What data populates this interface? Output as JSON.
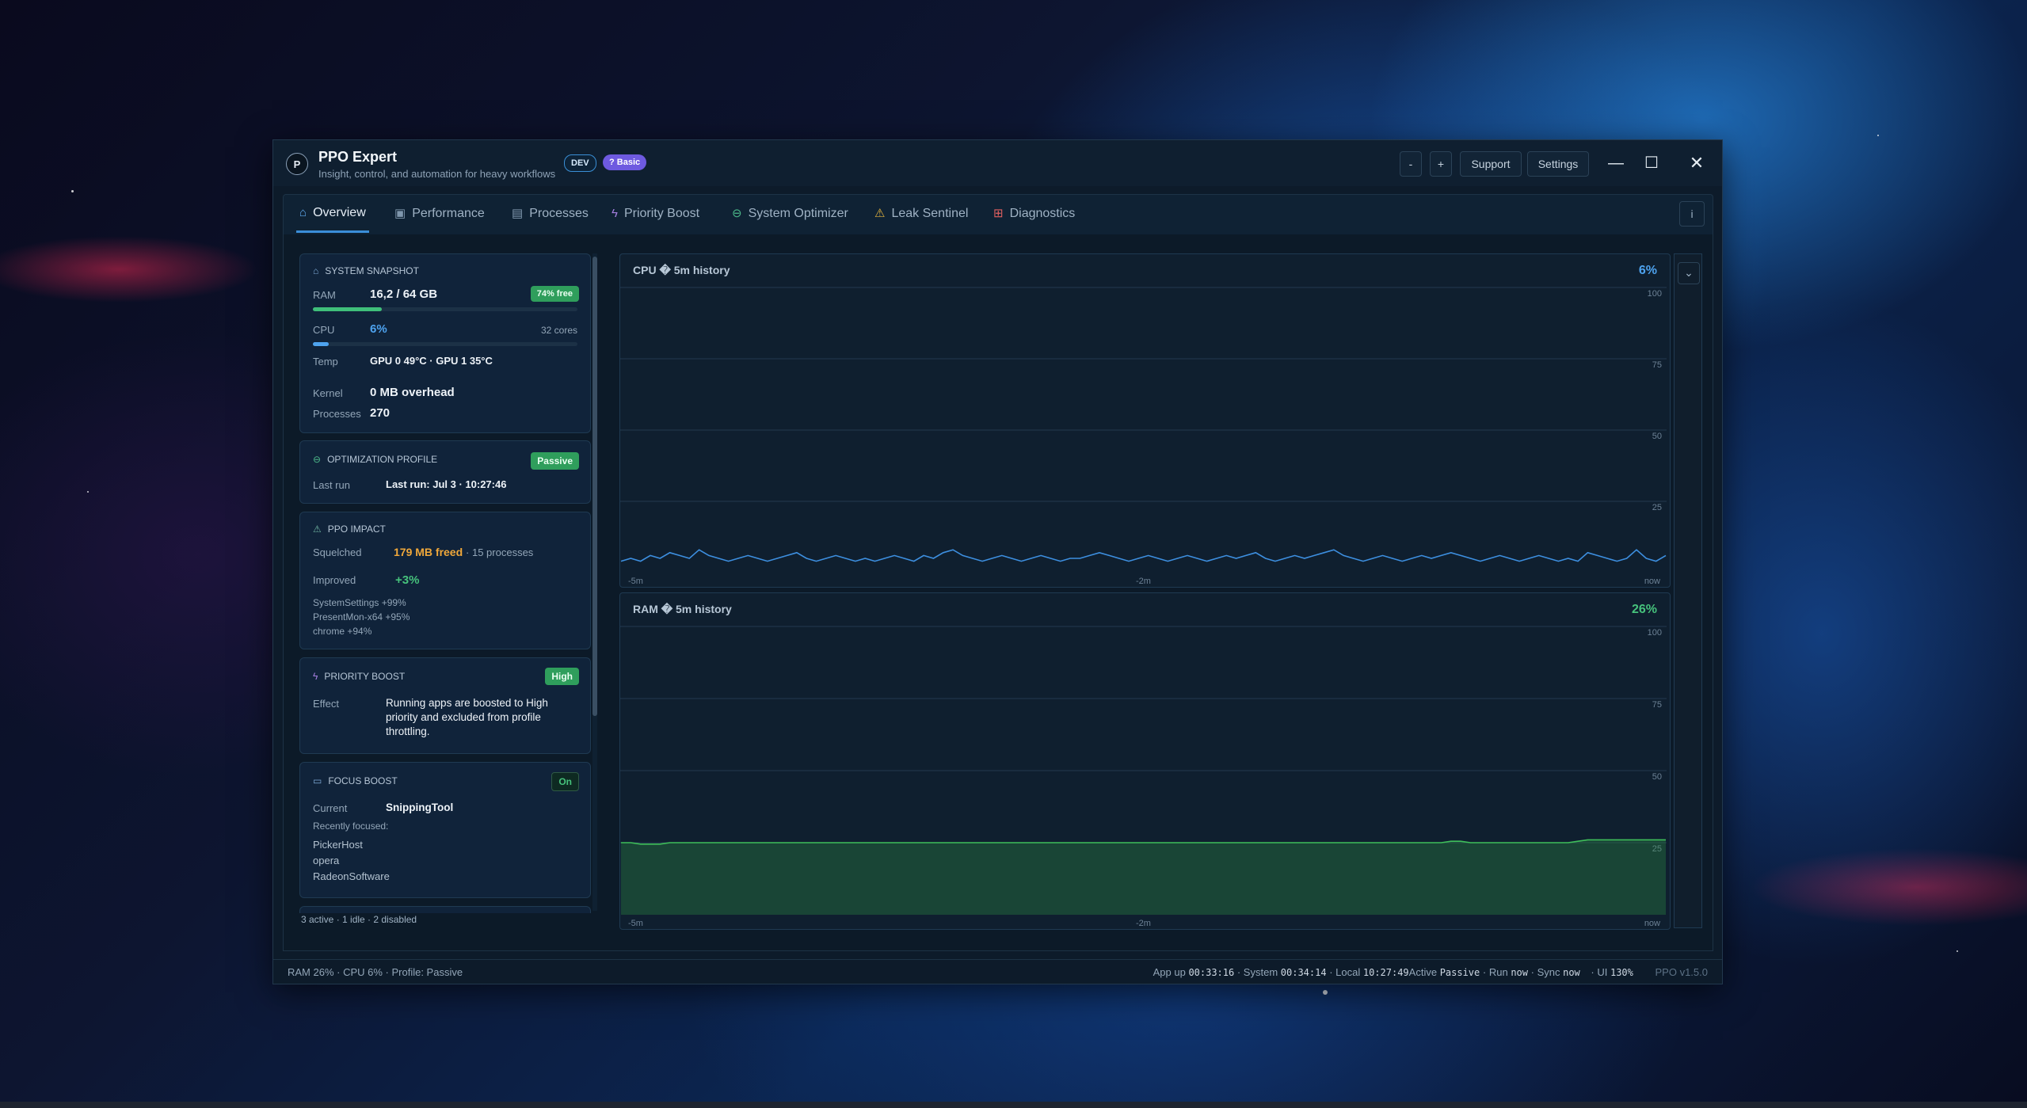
{
  "app": {
    "logo_letter": "P",
    "title": "PPO Expert",
    "subtitle": "Insight, control, and automation for heavy workflows",
    "badge_dev": "DEV",
    "badge_basic": "? Basic"
  },
  "titlebar": {
    "zoom_out": "-",
    "zoom_in": "+",
    "support": "Support",
    "settings": "Settings",
    "minimize": "—",
    "maximize": "☐",
    "close": "✕"
  },
  "tabs": [
    {
      "label": "Overview",
      "icon": "home-icon",
      "glyph": "⌂"
    },
    {
      "label": "Performance",
      "icon": "chart-icon",
      "glyph": "▣"
    },
    {
      "label": "Processes",
      "icon": "document-icon",
      "glyph": "▤"
    },
    {
      "label": "Priority Boost",
      "icon": "lightning-icon",
      "glyph": "ϟ"
    },
    {
      "label": "System Optimizer",
      "icon": "gamepad-icon",
      "glyph": "⊖"
    },
    {
      "label": "Leak Sentinel",
      "icon": "warning-icon",
      "glyph": "⚠"
    },
    {
      "label": "Diagnostics",
      "icon": "diagnostics-icon",
      "glyph": "⊞"
    }
  ],
  "info_button": "i",
  "snapshot": {
    "header": "SYSTEM SNAPSHOT",
    "ram_label": "RAM",
    "ram_value": "16,2 / 64 GB",
    "ram_free_badge": "74% free",
    "ram_percent": 26,
    "cpu_label": "CPU",
    "cpu_value": "6%",
    "cpu_cores": "32 cores",
    "cpu_percent": 6,
    "temp_label": "Temp",
    "temp_value": "GPU 0 49°C  ·  GPU 1 35°C",
    "kernel_label": "Kernel",
    "kernel_value": "0 MB overhead",
    "processes_label": "Processes",
    "processes_value": "270"
  },
  "optimization": {
    "header": "OPTIMIZATION PROFILE",
    "badge": "Passive",
    "last_run_label": "Last run",
    "last_run_value": "Last run: Jul 3 · 10:27:46"
  },
  "impact": {
    "header": "PPO IMPACT",
    "squelched_label": "Squelched",
    "squelched_value": "179 MB freed",
    "squelched_suffix": "· 15 processes",
    "improved_label": "Improved",
    "improved_value": "+3%",
    "items": [
      "SystemSettings  +99%",
      "PresentMon-x64  +95%",
      "chrome  +94%"
    ]
  },
  "priority_boost": {
    "header": "PRIORITY BOOST",
    "badge": "High",
    "effect_label": "Effect",
    "effect_value": "Running apps are boosted to High priority and excluded from profile throttling."
  },
  "focus_boost": {
    "header": "FOCUS BOOST",
    "badge": "On",
    "current_label": "Current",
    "current_value": "SnippingTool",
    "recent_label": "Recently focused:",
    "recent": [
      "PickerHost",
      "opera",
      "RadeonSoftware"
    ]
  },
  "sidebar_footer": "3 active  ·  1 idle  ·  2 disabled",
  "chart_data": [
    {
      "type": "line",
      "title": "CPU � 5m history",
      "current_value": "6%",
      "color": "#3d8fe0",
      "ylim": [
        0,
        100
      ],
      "yticks": [
        "100",
        "75",
        "50",
        "25"
      ],
      "xticks": [
        "-5m",
        "-2m",
        "now"
      ],
      "values": [
        4,
        5,
        4,
        6,
        5,
        7,
        6,
        5,
        8,
        6,
        5,
        4,
        5,
        6,
        5,
        4,
        5,
        6,
        7,
        5,
        4,
        5,
        6,
        5,
        4,
        5,
        4,
        5,
        6,
        5,
        4,
        6,
        5,
        7,
        8,
        6,
        5,
        4,
        5,
        6,
        5,
        4,
        5,
        6,
        5,
        4,
        5,
        5,
        6,
        7,
        6,
        5,
        4,
        5,
        6,
        5,
        4,
        5,
        6,
        5,
        4,
        5,
        6,
        5,
        6,
        7,
        5,
        4,
        5,
        6,
        5,
        6,
        7,
        8,
        6,
        5,
        4,
        5,
        6,
        5,
        4,
        5,
        6,
        5,
        6,
        7,
        6,
        5,
        4,
        5,
        6,
        5,
        4,
        5,
        6,
        5,
        4,
        5,
        4,
        7,
        6,
        5,
        4,
        5,
        8,
        5,
        4,
        6
      ]
    },
    {
      "type": "area",
      "title": "RAM � 5m history",
      "current_value": "26%",
      "color": "#3fbf5a",
      "ylim": [
        0,
        100
      ],
      "yticks": [
        "100",
        "75",
        "50",
        "25"
      ],
      "xticks": [
        "-5m",
        "-2m",
        "now"
      ],
      "values": [
        25,
        25,
        24.5,
        24.5,
        24.5,
        25,
        25,
        25,
        25,
        25,
        25,
        25,
        25,
        25,
        25,
        25,
        25,
        25,
        25,
        25,
        25,
        25,
        25,
        25,
        25,
        25,
        25,
        25,
        25,
        25,
        25,
        25,
        25,
        25,
        25,
        25,
        25,
        25,
        25,
        25,
        25,
        25,
        25,
        25,
        25,
        25,
        25,
        25,
        25,
        25,
        25,
        25,
        25,
        25,
        25,
        25,
        25,
        25,
        25,
        25,
        25,
        25,
        25,
        25,
        25,
        25,
        25,
        25,
        25,
        25,
        25,
        25,
        25,
        25,
        25,
        25,
        25,
        25,
        25,
        25,
        25,
        25,
        25,
        25,
        25,
        25.5,
        25.5,
        25,
        25,
        25,
        25,
        25,
        25,
        25,
        25,
        25,
        25,
        25,
        25.5,
        26,
        26,
        26,
        26,
        26,
        26,
        26,
        26,
        26
      ]
    }
  ],
  "chart_toggle": "⌄",
  "statusbar": {
    "left": "RAM 26%  ·  CPU 6%  ·  Profile: Passive",
    "app_up_label": "App up",
    "app_up": "00:33:16",
    "system_label": "· System",
    "system": "00:34:14",
    "local_label": "· Local",
    "local": "10:27:49",
    "active_label": "Active",
    "active": "Passive",
    "run_label": "· Run",
    "run": "now",
    "sync_label": "· Sync",
    "sync": "now",
    "ui_label": "· UI",
    "ui": "130%",
    "version": "PPO v1.5.0"
  }
}
